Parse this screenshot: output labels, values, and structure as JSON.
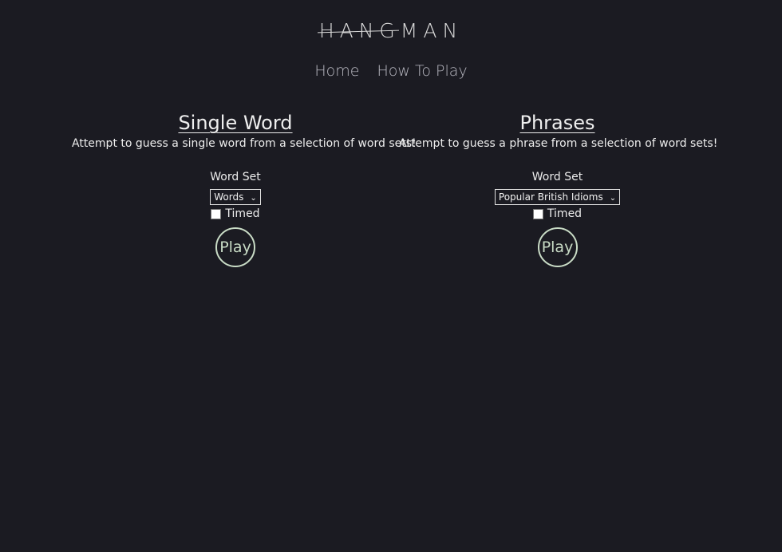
{
  "header": {
    "logo_struck": "HANG",
    "logo_rest": "MAN"
  },
  "nav": {
    "home_label": "Home",
    "how_to_play_label": "How To Play"
  },
  "single_word": {
    "title": "Single Word",
    "description": "Attempt to guess a single word from a selection of word sets!",
    "word_set_label": "Word Set",
    "word_set_selected": "Words",
    "timed_label": "Timed",
    "timed_checked": false,
    "play_label": "Play"
  },
  "phrases": {
    "title": "Phrases",
    "description": "Attempt to guess a phrase from a selection of word sets!",
    "word_set_label": "Word Set",
    "word_set_selected": "Popular British Idioms",
    "timed_label": "Timed",
    "timed_checked": false,
    "play_label": "Play"
  },
  "colors": {
    "background": "#1b1b22",
    "text": "#ededed",
    "play_accent": "#c9dcc6",
    "nav_text": "#b9b9c2"
  }
}
